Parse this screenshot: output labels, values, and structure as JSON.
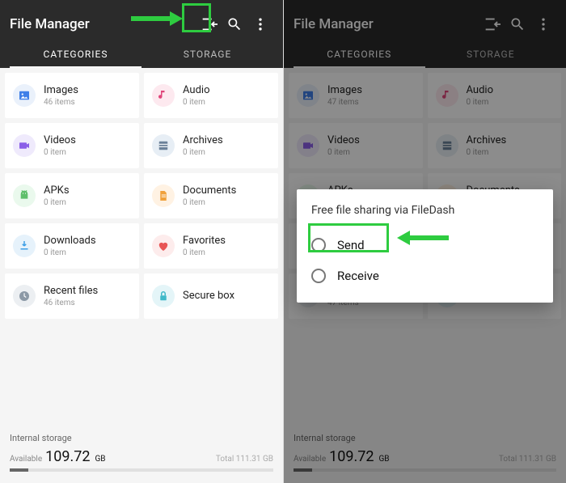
{
  "app_title": "File Manager",
  "tabs": {
    "categories": "CATEGORIES",
    "storage": "STORAGE"
  },
  "cards": [
    {
      "name": "Images",
      "sub_left": "46 items",
      "sub_right": "47 items",
      "bg": "#eaf1fb",
      "fg": "#3f7fe8",
      "glyph": "image"
    },
    {
      "name": "Audio",
      "sub_left": "0 item",
      "sub_right": "0 item",
      "bg": "#fde9ef",
      "fg": "#e0457a",
      "glyph": "note"
    },
    {
      "name": "Videos",
      "sub_left": "0 item",
      "sub_right": "0 item",
      "bg": "#efeafc",
      "fg": "#8a5ee8",
      "glyph": "video"
    },
    {
      "name": "Archives",
      "sub_left": "0 item",
      "sub_right": "0 item",
      "bg": "#e7eef5",
      "fg": "#6b8199",
      "glyph": "archive"
    },
    {
      "name": "APKs",
      "sub_left": "0 item",
      "sub_right": "0 item",
      "bg": "#eaf9ed",
      "fg": "#5fbf6b",
      "glyph": "android"
    },
    {
      "name": "Documents",
      "sub_left": "0 item",
      "sub_right": "0 item",
      "bg": "#fff2e3",
      "fg": "#f0a13c",
      "glyph": "doc"
    },
    {
      "name": "Downloads",
      "sub_left": "0 item",
      "sub_right": "0 item",
      "bg": "#e6f2fb",
      "fg": "#3e9fe6",
      "glyph": "download"
    },
    {
      "name": "Favorites",
      "sub_left": "0 item",
      "sub_right": "0 item",
      "bg": "#fdecec",
      "fg": "#e85454",
      "glyph": "heart"
    },
    {
      "name": "Recent files",
      "sub_left": "46 items",
      "sub_right": "47 items",
      "bg": "#eceff2",
      "fg": "#8c99a6",
      "glyph": "clock"
    },
    {
      "name": "Secure box",
      "sub_left": "",
      "sub_right": "",
      "bg": "#e4f5f8",
      "fg": "#3fb9c9",
      "glyph": "lock"
    }
  ],
  "storage": {
    "internal_label": "Internal storage",
    "available_label": "Available",
    "available_value": "109.72",
    "unit": "GB",
    "total_label": "Total 111.31 GB"
  },
  "dialog": {
    "title": "Free file sharing via FileDash",
    "send": "Send",
    "receive": "Receive"
  }
}
